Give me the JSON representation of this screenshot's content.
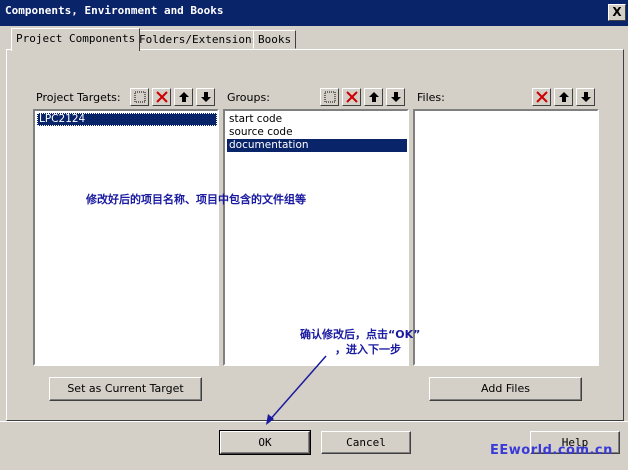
{
  "window": {
    "title": "Components, Environment and Books",
    "close_glyph": "X"
  },
  "tabs": [
    {
      "label": "Project Components",
      "active": true
    },
    {
      "label": "Folders/Extensions",
      "active": false
    },
    {
      "label": "Books",
      "active": false
    }
  ],
  "targets": {
    "label": "Project Targets:",
    "items": [
      "LPC2124"
    ],
    "selected": "LPC2124",
    "set_current_label": "Set as Current Target"
  },
  "groups": {
    "label": "Groups:",
    "items": [
      "start code",
      "source code",
      "documentation"
    ],
    "selected": "documentation"
  },
  "files": {
    "label": "Files:",
    "items": [],
    "add_label": "Add Files"
  },
  "toolbar_icons": [
    "new-icon",
    "delete-icon",
    "move-up-icon",
    "move-down-icon"
  ],
  "annotations": {
    "middle": "修改好后的项目名称、项目中包含的文件组等",
    "bottom_line1": "确认修改后，点击“OK”",
    "bottom_line2": "，进入下一步"
  },
  "buttons": {
    "ok": "OK",
    "cancel": "Cancel",
    "help": "Help"
  },
  "watermark": "EEworld.com.cn",
  "colors": {
    "titlebar": "#0a246a",
    "selection": "#0a246a",
    "annotation": "#1a1aa0",
    "delete_red": "#cc0000"
  }
}
